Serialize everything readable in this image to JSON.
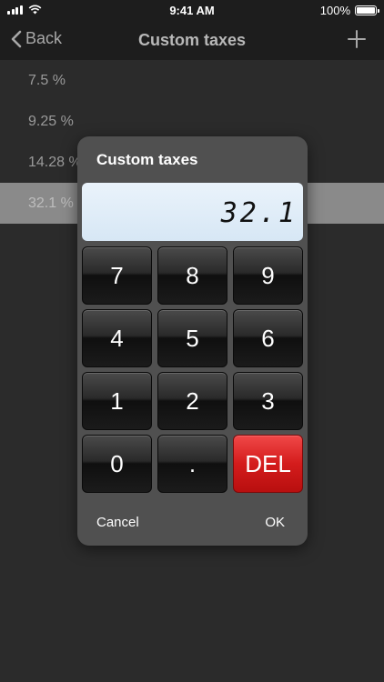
{
  "status_bar": {
    "time": "9:41 AM",
    "battery": "100%"
  },
  "nav": {
    "back_label": "Back",
    "title": "Custom taxes"
  },
  "tax_list": {
    "items": [
      "7.5 %",
      "9.25 %",
      "14.28 %",
      "32.1 %"
    ],
    "selected_index": 3
  },
  "dialog": {
    "title": "Custom taxes",
    "display_value": "32.1",
    "keys": [
      "7",
      "8",
      "9",
      "4",
      "5",
      "6",
      "1",
      "2",
      "3",
      "0",
      ".",
      "DEL"
    ],
    "cancel_label": "Cancel",
    "ok_label": "OK"
  },
  "colors": {
    "background": "#2b2b2b",
    "dialog": "#505050",
    "delete_key": "#d41c1c",
    "display": "#e3eef8"
  }
}
